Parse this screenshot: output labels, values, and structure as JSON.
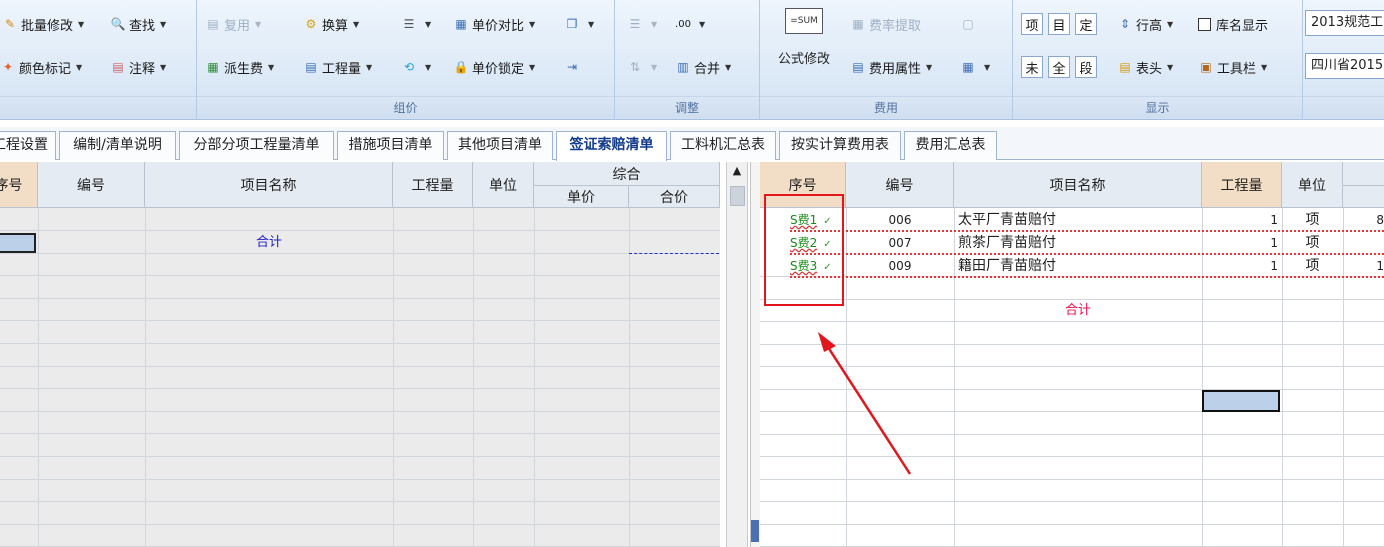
{
  "ribbon": {
    "groups": [
      {
        "label": "",
        "buttons": [
          {
            "label": "批量修改",
            "icon": "batch-edit-icon"
          },
          {
            "label": "查找",
            "icon": "search-icon"
          },
          {
            "label": "颜色标记",
            "icon": "color-mark-icon"
          },
          {
            "label": "注释",
            "icon": "comment-icon"
          }
        ]
      },
      {
        "label": "组价",
        "buttons": [
          {
            "label": "复用",
            "icon": "reuse-icon",
            "disabled": true
          },
          {
            "label": "换算",
            "icon": "convert-icon"
          },
          {
            "label": "",
            "icon": "list-icon"
          },
          {
            "label": "单价对比",
            "icon": "price-compare-icon"
          },
          {
            "label": "",
            "icon": "copy-icon"
          },
          {
            "label": "派生费",
            "icon": "derived-fee-icon"
          },
          {
            "label": "工程量",
            "icon": "quantity-icon"
          },
          {
            "label": "",
            "icon": "replace-icon"
          },
          {
            "label": "单价锁定",
            "icon": "lock-icon"
          },
          {
            "label": "",
            "icon": "export-icon"
          }
        ]
      },
      {
        "label": "调整",
        "buttons": [
          {
            "label": "",
            "icon": "indent-icon",
            "disabled": true
          },
          {
            "label": "",
            "icon": "decimal-icon"
          },
          {
            "label": "",
            "icon": "sort-icon",
            "disabled": true
          },
          {
            "label": "合并",
            "icon": "merge-icon"
          }
        ]
      },
      {
        "label": "费用",
        "buttons": [
          {
            "label": "公式修改",
            "icon": "sum-formula-icon"
          },
          {
            "label": "费率提取",
            "icon": "rate-extract-icon",
            "disabled": true
          },
          {
            "label": "",
            "icon": "preview-icon",
            "disabled": true
          },
          {
            "label": "费用属性",
            "icon": "fee-property-icon"
          },
          {
            "label": "",
            "icon": "calculator-icon"
          }
        ]
      },
      {
        "label": "显示",
        "buttons": [
          {
            "label": "项",
            "icon": ""
          },
          {
            "label": "目",
            "icon": ""
          },
          {
            "label": "定",
            "icon": ""
          },
          {
            "label": "行高",
            "icon": "row-height-icon"
          },
          {
            "label": "库名显示",
            "icon": "checkbox-icon"
          },
          {
            "label": "未",
            "icon": ""
          },
          {
            "label": "全",
            "icon": ""
          },
          {
            "label": "段",
            "icon": ""
          },
          {
            "label": "表头",
            "icon": "table-header-icon"
          },
          {
            "label": "工具栏",
            "icon": "toolbar-icon"
          }
        ]
      }
    ],
    "combos": [
      {
        "value": "2013规范工"
      },
      {
        "value": "四川省2015"
      }
    ]
  },
  "tabs": [
    {
      "label": "工程设置"
    },
    {
      "label": "编制/清单说明"
    },
    {
      "label": "分部分项工程量清单"
    },
    {
      "label": "措施项目清单"
    },
    {
      "label": "其他项目清单"
    },
    {
      "label": "签证索赔清单",
      "active": true
    },
    {
      "label": "工料机汇总表"
    },
    {
      "label": "按实计算费用表"
    },
    {
      "label": "费用汇总表"
    }
  ],
  "left_grid": {
    "headers": [
      "序号",
      "编号",
      "项目名称",
      "工程量",
      "单位",
      "综合",
      "单价",
      "合价"
    ],
    "total_label": "合计"
  },
  "right_grid": {
    "headers": [
      "序号",
      "编号",
      "项目名称",
      "工程量",
      "单位",
      "单"
    ],
    "rows": [
      {
        "seq": "S费1",
        "code": "006",
        "name": "太平厂青苗赔付",
        "qty": "1",
        "unit": "项",
        "price": "8"
      },
      {
        "seq": "S费2",
        "code": "007",
        "name": "煎茶厂青苗赔付",
        "qty": "1",
        "unit": "项",
        "price": ""
      },
      {
        "seq": "S费3",
        "code": "009",
        "name": "籍田厂青苗赔付",
        "qty": "1",
        "unit": "项",
        "price": "1"
      }
    ],
    "total_label": "合计"
  },
  "colors": {
    "highlight_box": "#e3161e",
    "arrow": "#e3161e",
    "seq_text": "#1a8a1a",
    "total_text": "#e8114a"
  }
}
